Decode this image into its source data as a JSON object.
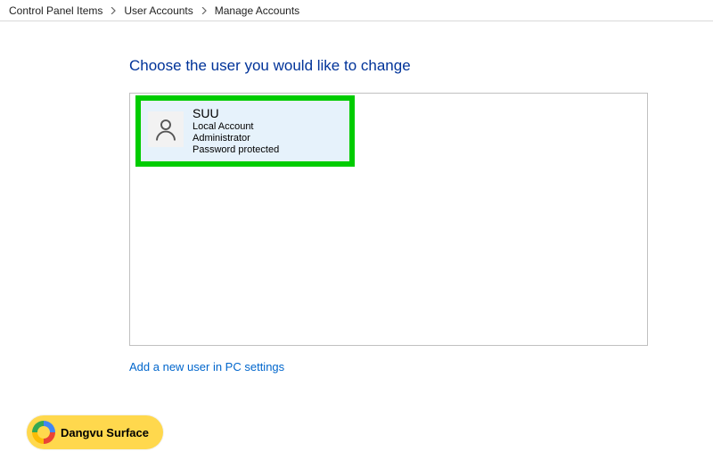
{
  "breadcrumb": {
    "items": [
      {
        "label": "Control Panel Items"
      },
      {
        "label": "User Accounts"
      },
      {
        "label": "Manage Accounts"
      }
    ]
  },
  "page": {
    "heading": "Choose the user you would like to change",
    "add_user_link": "Add a new user in PC settings"
  },
  "accounts": [
    {
      "name": "SUU",
      "type": "Local Account",
      "role": "Administrator",
      "protection": "Password protected"
    }
  ],
  "badge": {
    "text": "Dangvu Surface"
  }
}
